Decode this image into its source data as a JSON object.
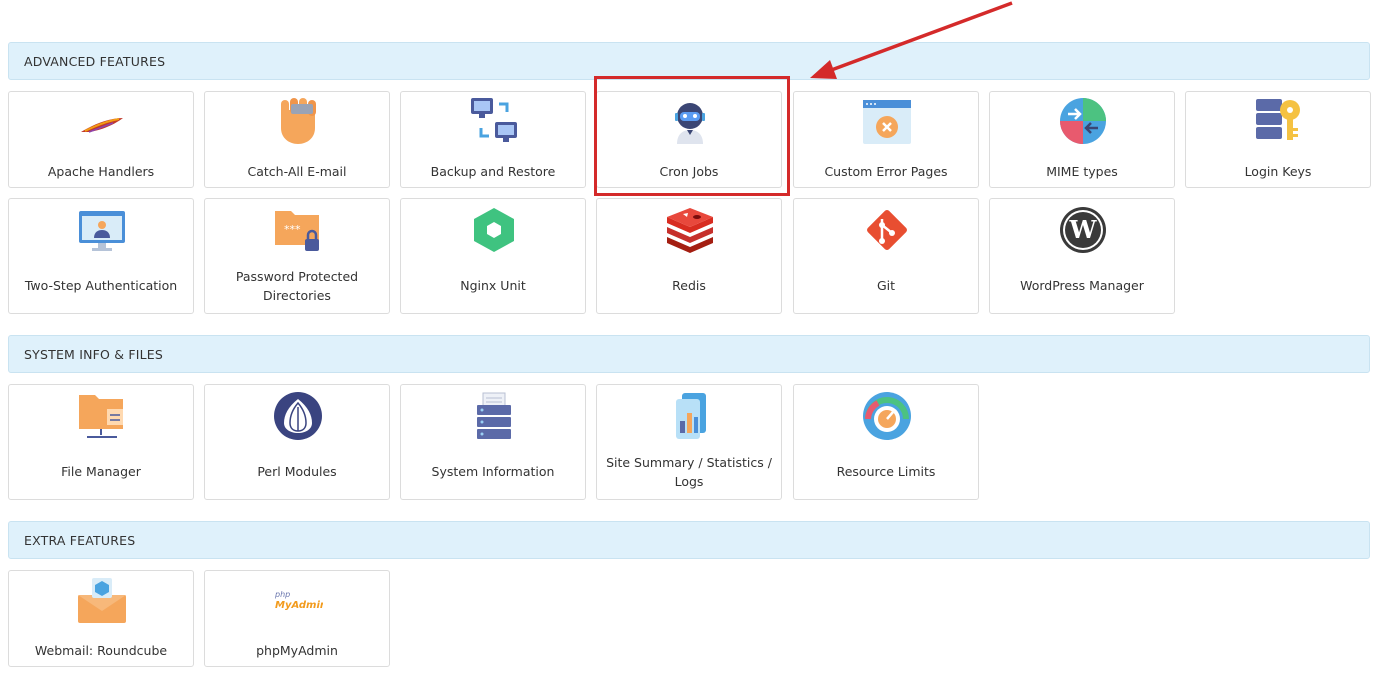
{
  "sections": {
    "advanced": {
      "title": "ADVANCED FEATURES",
      "tiles": [
        {
          "label": "Apache Handlers",
          "icon": "apache-feather-icon"
        },
        {
          "label": "Catch-All E-mail",
          "icon": "catch-all-hand-icon"
        },
        {
          "label": "Backup and Restore",
          "icon": "backup-restore-icon"
        },
        {
          "label": "Cron Jobs",
          "icon": "cron-robot-icon"
        },
        {
          "label": "Custom Error Pages",
          "icon": "error-page-icon"
        },
        {
          "label": "MIME types",
          "icon": "mime-types-icon"
        },
        {
          "label": "Login Keys",
          "icon": "login-keys-icon"
        },
        {
          "label": "Two-Step Authentication",
          "icon": "two-step-auth-icon"
        },
        {
          "label": "Password Protected Directories",
          "icon": "password-folder-icon"
        },
        {
          "label": "Nginx Unit",
          "icon": "nginx-unit-icon"
        },
        {
          "label": "Redis",
          "icon": "redis-icon"
        },
        {
          "label": "Git",
          "icon": "git-icon"
        },
        {
          "label": "WordPress Manager",
          "icon": "wordpress-icon"
        }
      ]
    },
    "system": {
      "title": "SYSTEM INFO & FILES",
      "tiles": [
        {
          "label": "File Manager",
          "icon": "folder-icon"
        },
        {
          "label": "Perl Modules",
          "icon": "perl-onion-icon"
        },
        {
          "label": "System Information",
          "icon": "server-icon"
        },
        {
          "label": "Site Summary / Statistics / Logs",
          "icon": "statistics-icon"
        },
        {
          "label": "Resource Limits",
          "icon": "gauge-icon"
        }
      ]
    },
    "extra": {
      "title": "EXTRA FEATURES",
      "tiles": [
        {
          "label": "Webmail: Roundcube",
          "icon": "roundcube-mail-icon"
        },
        {
          "label": "phpMyAdmin",
          "icon": "phpmyadmin-logo-icon",
          "logo_text_top": "php",
          "logo_text_bottom": "MyAdmin"
        }
      ]
    }
  },
  "highlight": {
    "target": "Cron Jobs",
    "color": "#d42a2a"
  }
}
